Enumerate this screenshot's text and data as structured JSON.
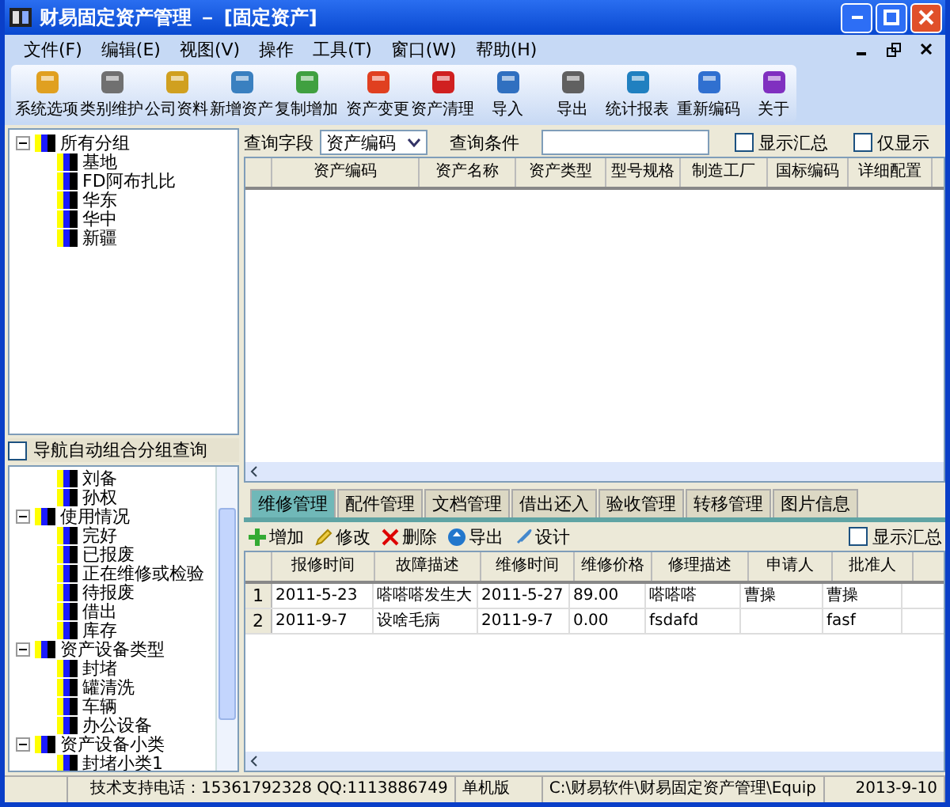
{
  "window": {
    "title": "财易固定资产管理 － [固定资产]"
  },
  "menu": [
    "文件(F)",
    "编辑(E)",
    "视图(V)",
    "操作",
    "工具(T)",
    "窗口(W)",
    "帮助(H)"
  ],
  "toolbar_groups": [
    [
      "系统选项",
      "类别维护",
      "公司资料",
      "新增资产",
      "复制增加"
    ],
    [
      "资产变更",
      "资产清理",
      "导入",
      "导出",
      "统计报表"
    ],
    [
      "重新编码",
      "关于"
    ]
  ],
  "group_tree": [
    {
      "label": "所有分组",
      "expanded": true,
      "children": [
        {
          "label": "基地"
        },
        {
          "label": "FD阿布扎比"
        },
        {
          "label": "华东"
        },
        {
          "label": "华中"
        },
        {
          "label": "新疆"
        }
      ]
    }
  ],
  "nav_query": {
    "label": "导航自动组合分组查询",
    "checked": false
  },
  "nav_tree": {
    "cut_children": [
      {
        "label": "刘备"
      },
      {
        "label": "孙权"
      }
    ],
    "groups": [
      {
        "label": "使用情况",
        "expanded": true,
        "children": [
          {
            "label": "完好"
          },
          {
            "label": "已报废"
          },
          {
            "label": "正在维修或检验"
          },
          {
            "label": "待报废"
          },
          {
            "label": "借出"
          },
          {
            "label": "库存"
          }
        ]
      },
      {
        "label": "资产设备类型",
        "expanded": true,
        "children": [
          {
            "label": "封堵"
          },
          {
            "label": "罐清洗"
          },
          {
            "label": "车辆"
          },
          {
            "label": "办公设备"
          }
        ]
      },
      {
        "label": "资产设备小类",
        "expanded": true,
        "children": [
          {
            "label": "封堵小类1"
          }
        ]
      }
    ]
  },
  "query": {
    "field_label": "查询字段",
    "field_value": "资产编码",
    "condition_label": "查询条件",
    "show_total": {
      "label": "显示汇总",
      "checked": false
    },
    "only_show": {
      "label": "仅显示",
      "checked": false
    }
  },
  "asset_table": {
    "columns": [
      "资产编码",
      "资产名称",
      "资产类型",
      "型号规格",
      "制造工厂",
      "国标编码",
      "详细配置"
    ]
  },
  "tabs": [
    {
      "label": "维修管理",
      "selected": true
    },
    {
      "label": "配件管理",
      "selected": false
    },
    {
      "label": "文档管理",
      "selected": false
    },
    {
      "label": "借出还入",
      "selected": false
    },
    {
      "label": "验收管理",
      "selected": false
    },
    {
      "label": "转移管理",
      "selected": false
    },
    {
      "label": "图片信息",
      "selected": false
    }
  ],
  "detail_toolbar": [
    "增加",
    "修改",
    "删除",
    "导出",
    "设计"
  ],
  "detail_show_total": {
    "label": "显示汇总",
    "checked": false
  },
  "repair_table": {
    "columns": [
      "报修时间",
      "故障描述",
      "维修时间",
      "维修价格",
      "修理描述",
      "申请人",
      "批准人"
    ],
    "rows": [
      {
        "index": "1",
        "cells": [
          "2011-5-23",
          "嗒嗒嗒发生大",
          "2011-5-27",
          "89.00",
          "嗒嗒嗒",
          "曹操",
          "曹操"
        ]
      },
      {
        "index": "2",
        "cells": [
          "2011-9-7",
          "设啥毛病",
          "2011-9-7",
          "0.00",
          "fsdafd",
          "",
          "fasf"
        ]
      }
    ]
  },
  "status_bar": [
    "技术支持电话：15361792328 QQ:1113886749",
    "单机版",
    "C:\\财易软件\\财易固定资产管理\\Equip",
    "2013-9-10"
  ]
}
